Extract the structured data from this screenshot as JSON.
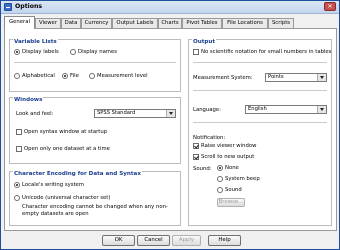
{
  "window": {
    "title": "Options",
    "close_glyph": "✕"
  },
  "tabs": [
    "General",
    "Viewer",
    "Data",
    "Currency",
    "Output Labels",
    "Charts",
    "Pivot Tables",
    "File Locations",
    "Scripts"
  ],
  "active_tab": "General",
  "variable_lists": {
    "title": "Variable Lists",
    "display_labels": "Display labels",
    "display_names": "Display names",
    "alphabetical": "Alphabetical",
    "file": "File",
    "measurement_level": "Measurement level",
    "selected_display": "Display labels",
    "selected_order": "File"
  },
  "windows": {
    "title": "Windows",
    "look_and_feel_label": "Look and feel:",
    "look_and_feel_value": "SPSS Standard",
    "open_syntax": "Open syntax window at startup",
    "open_one_dataset": "Open only one dataset at a time"
  },
  "char_encoding": {
    "title": "Character Encoding for Data and Syntax",
    "locale": "Locale's writing system",
    "unicode": "Unicode (universal character set)",
    "note": "Character encoding cannot be changed when any non-empty datasets are open",
    "selected": "Locale's writing system"
  },
  "output": {
    "title": "Output",
    "no_scientific": "No scientific notation for small numbers in tables",
    "measurement_label": "Measurement System:",
    "measurement_value": "Points",
    "language_label": "Language:",
    "language_value": "English",
    "notification_label": "Notification:",
    "raise_viewer": "Raise viewer window",
    "scroll_new": "Scroll to new output",
    "sound_label": "Sound:",
    "sound_none": "None",
    "sound_beep": "System beep",
    "sound_sound": "Sound",
    "browse": "Browse...",
    "sound_selected": "None"
  },
  "buttons": {
    "ok": "OK",
    "cancel": "Cancel",
    "apply": "Apply",
    "help": "Help"
  },
  "colors": {
    "title_text": "#1a3d8f",
    "window_border": "#1c4fa0"
  }
}
